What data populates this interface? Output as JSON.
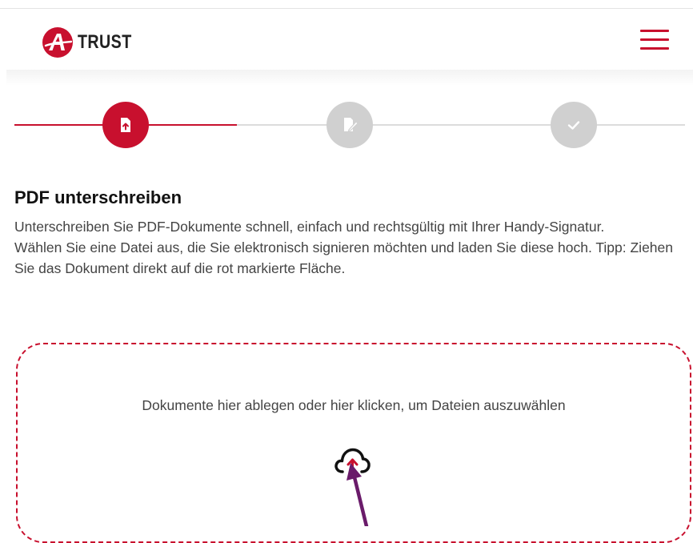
{
  "header": {
    "logo_letter": "A",
    "logo_text": "TRUST",
    "menu_icon": "hamburger-menu-icon",
    "brand_color": "#c8102e"
  },
  "stepper": {
    "current_step": 1,
    "steps": [
      {
        "icon": "file-upload-icon",
        "state": "active"
      },
      {
        "icon": "file-sign-icon",
        "state": "inactive"
      },
      {
        "icon": "check-icon",
        "state": "inactive"
      }
    ]
  },
  "main": {
    "title": "PDF unterschreiben",
    "description_1": "Unterschreiben Sie PDF-Dokumente schnell, einfach und rechtsgültig mit Ihrer Handy-Signatur.",
    "description_2": "Wählen Sie eine Datei aus, die Sie elektronisch signieren möchten und laden Sie diese hoch. Tipp: Ziehen Sie das Dokument direkt auf die rot markierte Fläche."
  },
  "dropzone": {
    "text": "Dokumente hier ablegen oder hier klicken, um Dateien auszuwählen",
    "icon": "cloud-upload-icon"
  },
  "annotation": {
    "icon": "pointer-arrow-icon",
    "color": "#6a1b6a"
  }
}
